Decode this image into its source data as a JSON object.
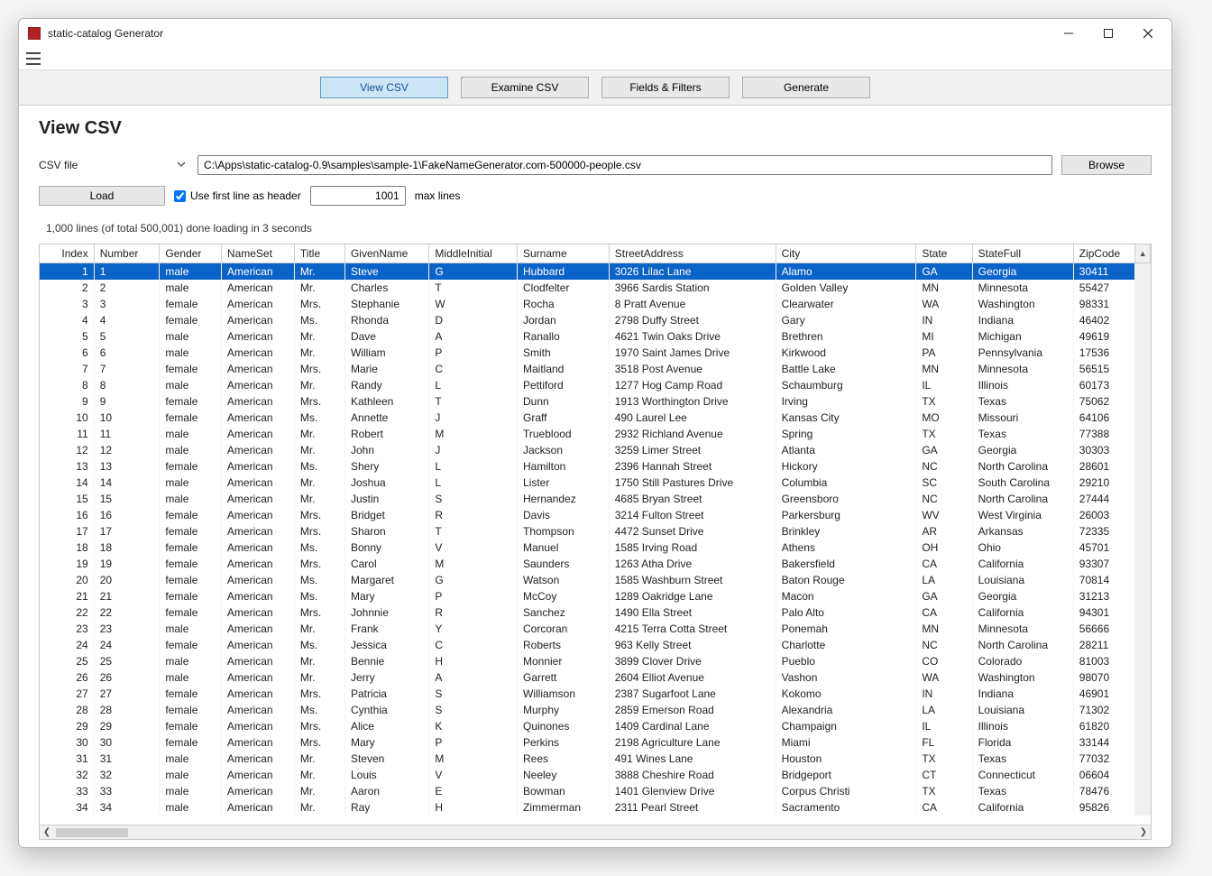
{
  "window": {
    "title": "static-catalog Generator"
  },
  "tabs": {
    "view_csv": "View CSV",
    "examine_csv": "Examine CSV",
    "fields_filters": "Fields & Filters",
    "generate": "Generate"
  },
  "page": {
    "title": "View CSV"
  },
  "file": {
    "label": "CSV file",
    "path": "C:\\Apps\\static-catalog-0.9\\samples\\sample-1\\FakeNameGenerator.com-500000-people.csv",
    "browse": "Browse"
  },
  "controls": {
    "load": "Load",
    "use_first_line": "Use first line as header",
    "max_lines_value": "1001",
    "max_lines_label": "max lines"
  },
  "status": "1,000 lines (of total 500,001) done loading in 3 seconds",
  "columns": [
    "Index",
    "Number",
    "Gender",
    "NameSet",
    "Title",
    "GivenName",
    "MiddleInitial",
    "Surname",
    "StreetAddress",
    "City",
    "State",
    "StateFull",
    "ZipCode"
  ],
  "rows": [
    {
      "Index": "1",
      "Number": "1",
      "Gender": "male",
      "NameSet": "American",
      "Title": "Mr.",
      "GivenName": "Steve",
      "MiddleInitial": "G",
      "Surname": "Hubbard",
      "StreetAddress": "3026 Lilac Lane",
      "City": "Alamo",
      "State": "GA",
      "StateFull": "Georgia",
      "ZipCode": "30411",
      "selected": true
    },
    {
      "Index": "2",
      "Number": "2",
      "Gender": "male",
      "NameSet": "American",
      "Title": "Mr.",
      "GivenName": "Charles",
      "MiddleInitial": "T",
      "Surname": "Clodfelter",
      "StreetAddress": "3966 Sardis Station",
      "City": "Golden Valley",
      "State": "MN",
      "StateFull": "Minnesota",
      "ZipCode": "55427"
    },
    {
      "Index": "3",
      "Number": "3",
      "Gender": "female",
      "NameSet": "American",
      "Title": "Mrs.",
      "GivenName": "Stephanie",
      "MiddleInitial": "W",
      "Surname": "Rocha",
      "StreetAddress": "8 Pratt Avenue",
      "City": "Clearwater",
      "State": "WA",
      "StateFull": "Washington",
      "ZipCode": "98331"
    },
    {
      "Index": "4",
      "Number": "4",
      "Gender": "female",
      "NameSet": "American",
      "Title": "Ms.",
      "GivenName": "Rhonda",
      "MiddleInitial": "D",
      "Surname": "Jordan",
      "StreetAddress": "2798 Duffy Street",
      "City": "Gary",
      "State": "IN",
      "StateFull": "Indiana",
      "ZipCode": "46402"
    },
    {
      "Index": "5",
      "Number": "5",
      "Gender": "male",
      "NameSet": "American",
      "Title": "Mr.",
      "GivenName": "Dave",
      "MiddleInitial": "A",
      "Surname": "Ranallo",
      "StreetAddress": "4621 Twin Oaks Drive",
      "City": "Brethren",
      "State": "MI",
      "StateFull": "Michigan",
      "ZipCode": "49619"
    },
    {
      "Index": "6",
      "Number": "6",
      "Gender": "male",
      "NameSet": "American",
      "Title": "Mr.",
      "GivenName": "William",
      "MiddleInitial": "P",
      "Surname": "Smith",
      "StreetAddress": "1970 Saint James Drive",
      "City": "Kirkwood",
      "State": "PA",
      "StateFull": "Pennsylvania",
      "ZipCode": "17536"
    },
    {
      "Index": "7",
      "Number": "7",
      "Gender": "female",
      "NameSet": "American",
      "Title": "Mrs.",
      "GivenName": "Marie",
      "MiddleInitial": "C",
      "Surname": "Maitland",
      "StreetAddress": "3518 Post Avenue",
      "City": "Battle Lake",
      "State": "MN",
      "StateFull": "Minnesota",
      "ZipCode": "56515"
    },
    {
      "Index": "8",
      "Number": "8",
      "Gender": "male",
      "NameSet": "American",
      "Title": "Mr.",
      "GivenName": "Randy",
      "MiddleInitial": "L",
      "Surname": "Pettiford",
      "StreetAddress": "1277 Hog Camp Road",
      "City": "Schaumburg",
      "State": "IL",
      "StateFull": "Illinois",
      "ZipCode": "60173"
    },
    {
      "Index": "9",
      "Number": "9",
      "Gender": "female",
      "NameSet": "American",
      "Title": "Mrs.",
      "GivenName": "Kathleen",
      "MiddleInitial": "T",
      "Surname": "Dunn",
      "StreetAddress": "1913 Worthington Drive",
      "City": "Irving",
      "State": "TX",
      "StateFull": "Texas",
      "ZipCode": "75062"
    },
    {
      "Index": "10",
      "Number": "10",
      "Gender": "female",
      "NameSet": "American",
      "Title": "Ms.",
      "GivenName": "Annette",
      "MiddleInitial": "J",
      "Surname": "Graff",
      "StreetAddress": "490 Laurel Lee",
      "City": "Kansas City",
      "State": "MO",
      "StateFull": "Missouri",
      "ZipCode": "64106"
    },
    {
      "Index": "11",
      "Number": "11",
      "Gender": "male",
      "NameSet": "American",
      "Title": "Mr.",
      "GivenName": "Robert",
      "MiddleInitial": "M",
      "Surname": "Trueblood",
      "StreetAddress": "2932 Richland Avenue",
      "City": "Spring",
      "State": "TX",
      "StateFull": "Texas",
      "ZipCode": "77388"
    },
    {
      "Index": "12",
      "Number": "12",
      "Gender": "male",
      "NameSet": "American",
      "Title": "Mr.",
      "GivenName": "John",
      "MiddleInitial": "J",
      "Surname": "Jackson",
      "StreetAddress": "3259 Limer Street",
      "City": "Atlanta",
      "State": "GA",
      "StateFull": "Georgia",
      "ZipCode": "30303"
    },
    {
      "Index": "13",
      "Number": "13",
      "Gender": "female",
      "NameSet": "American",
      "Title": "Ms.",
      "GivenName": "Shery",
      "MiddleInitial": "L",
      "Surname": "Hamilton",
      "StreetAddress": "2396 Hannah Street",
      "City": "Hickory",
      "State": "NC",
      "StateFull": "North Carolina",
      "ZipCode": "28601"
    },
    {
      "Index": "14",
      "Number": "14",
      "Gender": "male",
      "NameSet": "American",
      "Title": "Mr.",
      "GivenName": "Joshua",
      "MiddleInitial": "L",
      "Surname": "Lister",
      "StreetAddress": "1750 Still Pastures Drive",
      "City": "Columbia",
      "State": "SC",
      "StateFull": "South Carolina",
      "ZipCode": "29210"
    },
    {
      "Index": "15",
      "Number": "15",
      "Gender": "male",
      "NameSet": "American",
      "Title": "Mr.",
      "GivenName": "Justin",
      "MiddleInitial": "S",
      "Surname": "Hernandez",
      "StreetAddress": "4685 Bryan Street",
      "City": "Greensboro",
      "State": "NC",
      "StateFull": "North Carolina",
      "ZipCode": "27444"
    },
    {
      "Index": "16",
      "Number": "16",
      "Gender": "female",
      "NameSet": "American",
      "Title": "Mrs.",
      "GivenName": "Bridget",
      "MiddleInitial": "R",
      "Surname": "Davis",
      "StreetAddress": "3214 Fulton Street",
      "City": "Parkersburg",
      "State": "WV",
      "StateFull": "West Virginia",
      "ZipCode": "26003"
    },
    {
      "Index": "17",
      "Number": "17",
      "Gender": "female",
      "NameSet": "American",
      "Title": "Mrs.",
      "GivenName": "Sharon",
      "MiddleInitial": "T",
      "Surname": "Thompson",
      "StreetAddress": "4472 Sunset Drive",
      "City": "Brinkley",
      "State": "AR",
      "StateFull": "Arkansas",
      "ZipCode": "72335"
    },
    {
      "Index": "18",
      "Number": "18",
      "Gender": "female",
      "NameSet": "American",
      "Title": "Ms.",
      "GivenName": "Bonny",
      "MiddleInitial": "V",
      "Surname": "Manuel",
      "StreetAddress": "1585 Irving Road",
      "City": "Athens",
      "State": "OH",
      "StateFull": "Ohio",
      "ZipCode": "45701"
    },
    {
      "Index": "19",
      "Number": "19",
      "Gender": "female",
      "NameSet": "American",
      "Title": "Mrs.",
      "GivenName": "Carol",
      "MiddleInitial": "M",
      "Surname": "Saunders",
      "StreetAddress": "1263 Atha Drive",
      "City": "Bakersfield",
      "State": "CA",
      "StateFull": "California",
      "ZipCode": "93307"
    },
    {
      "Index": "20",
      "Number": "20",
      "Gender": "female",
      "NameSet": "American",
      "Title": "Ms.",
      "GivenName": "Margaret",
      "MiddleInitial": "G",
      "Surname": "Watson",
      "StreetAddress": "1585 Washburn Street",
      "City": "Baton Rouge",
      "State": "LA",
      "StateFull": "Louisiana",
      "ZipCode": "70814"
    },
    {
      "Index": "21",
      "Number": "21",
      "Gender": "female",
      "NameSet": "American",
      "Title": "Ms.",
      "GivenName": "Mary",
      "MiddleInitial": "P",
      "Surname": "McCoy",
      "StreetAddress": "1289 Oakridge Lane",
      "City": "Macon",
      "State": "GA",
      "StateFull": "Georgia",
      "ZipCode": "31213"
    },
    {
      "Index": "22",
      "Number": "22",
      "Gender": "female",
      "NameSet": "American",
      "Title": "Mrs.",
      "GivenName": "Johnnie",
      "MiddleInitial": "R",
      "Surname": "Sanchez",
      "StreetAddress": "1490 Ella Street",
      "City": "Palo Alto",
      "State": "CA",
      "StateFull": "California",
      "ZipCode": "94301"
    },
    {
      "Index": "23",
      "Number": "23",
      "Gender": "male",
      "NameSet": "American",
      "Title": "Mr.",
      "GivenName": "Frank",
      "MiddleInitial": "Y",
      "Surname": "Corcoran",
      "StreetAddress": "4215 Terra Cotta Street",
      "City": "Ponemah",
      "State": "MN",
      "StateFull": "Minnesota",
      "ZipCode": "56666"
    },
    {
      "Index": "24",
      "Number": "24",
      "Gender": "female",
      "NameSet": "American",
      "Title": "Ms.",
      "GivenName": "Jessica",
      "MiddleInitial": "C",
      "Surname": "Roberts",
      "StreetAddress": "963 Kelly Street",
      "City": "Charlotte",
      "State": "NC",
      "StateFull": "North Carolina",
      "ZipCode": "28211"
    },
    {
      "Index": "25",
      "Number": "25",
      "Gender": "male",
      "NameSet": "American",
      "Title": "Mr.",
      "GivenName": "Bennie",
      "MiddleInitial": "H",
      "Surname": "Monnier",
      "StreetAddress": "3899 Clover Drive",
      "City": "Pueblo",
      "State": "CO",
      "StateFull": "Colorado",
      "ZipCode": "81003"
    },
    {
      "Index": "26",
      "Number": "26",
      "Gender": "male",
      "NameSet": "American",
      "Title": "Mr.",
      "GivenName": "Jerry",
      "MiddleInitial": "A",
      "Surname": "Garrett",
      "StreetAddress": "2604 Elliot Avenue",
      "City": "Vashon",
      "State": "WA",
      "StateFull": "Washington",
      "ZipCode": "98070"
    },
    {
      "Index": "27",
      "Number": "27",
      "Gender": "female",
      "NameSet": "American",
      "Title": "Mrs.",
      "GivenName": "Patricia",
      "MiddleInitial": "S",
      "Surname": "Williamson",
      "StreetAddress": "2387 Sugarfoot Lane",
      "City": "Kokomo",
      "State": "IN",
      "StateFull": "Indiana",
      "ZipCode": "46901"
    },
    {
      "Index": "28",
      "Number": "28",
      "Gender": "female",
      "NameSet": "American",
      "Title": "Ms.",
      "GivenName": "Cynthia",
      "MiddleInitial": "S",
      "Surname": "Murphy",
      "StreetAddress": "2859 Emerson Road",
      "City": "Alexandria",
      "State": "LA",
      "StateFull": "Louisiana",
      "ZipCode": "71302"
    },
    {
      "Index": "29",
      "Number": "29",
      "Gender": "female",
      "NameSet": "American",
      "Title": "Mrs.",
      "GivenName": "Alice",
      "MiddleInitial": "K",
      "Surname": "Quinones",
      "StreetAddress": "1409 Cardinal Lane",
      "City": "Champaign",
      "State": "IL",
      "StateFull": "Illinois",
      "ZipCode": "61820"
    },
    {
      "Index": "30",
      "Number": "30",
      "Gender": "female",
      "NameSet": "American",
      "Title": "Mrs.",
      "GivenName": "Mary",
      "MiddleInitial": "P",
      "Surname": "Perkins",
      "StreetAddress": "2198 Agriculture Lane",
      "City": "Miami",
      "State": "FL",
      "StateFull": "Florida",
      "ZipCode": "33144"
    },
    {
      "Index": "31",
      "Number": "31",
      "Gender": "male",
      "NameSet": "American",
      "Title": "Mr.",
      "GivenName": "Steven",
      "MiddleInitial": "M",
      "Surname": "Rees",
      "StreetAddress": "491 Wines Lane",
      "City": "Houston",
      "State": "TX",
      "StateFull": "Texas",
      "ZipCode": "77032"
    },
    {
      "Index": "32",
      "Number": "32",
      "Gender": "male",
      "NameSet": "American",
      "Title": "Mr.",
      "GivenName": "Louis",
      "MiddleInitial": "V",
      "Surname": "Neeley",
      "StreetAddress": "3888 Cheshire Road",
      "City": "Bridgeport",
      "State": "CT",
      "StateFull": "Connecticut",
      "ZipCode": "06604"
    },
    {
      "Index": "33",
      "Number": "33",
      "Gender": "male",
      "NameSet": "American",
      "Title": "Mr.",
      "GivenName": "Aaron",
      "MiddleInitial": "E",
      "Surname": "Bowman",
      "StreetAddress": "1401 Glenview Drive",
      "City": "Corpus Christi",
      "State": "TX",
      "StateFull": "Texas",
      "ZipCode": "78476"
    },
    {
      "Index": "34",
      "Number": "34",
      "Gender": "male",
      "NameSet": "American",
      "Title": "Mr.",
      "GivenName": "Ray",
      "MiddleInitial": "H",
      "Surname": "Zimmerman",
      "StreetAddress": "2311 Pearl Street",
      "City": "Sacramento",
      "State": "CA",
      "StateFull": "California",
      "ZipCode": "95826"
    }
  ]
}
